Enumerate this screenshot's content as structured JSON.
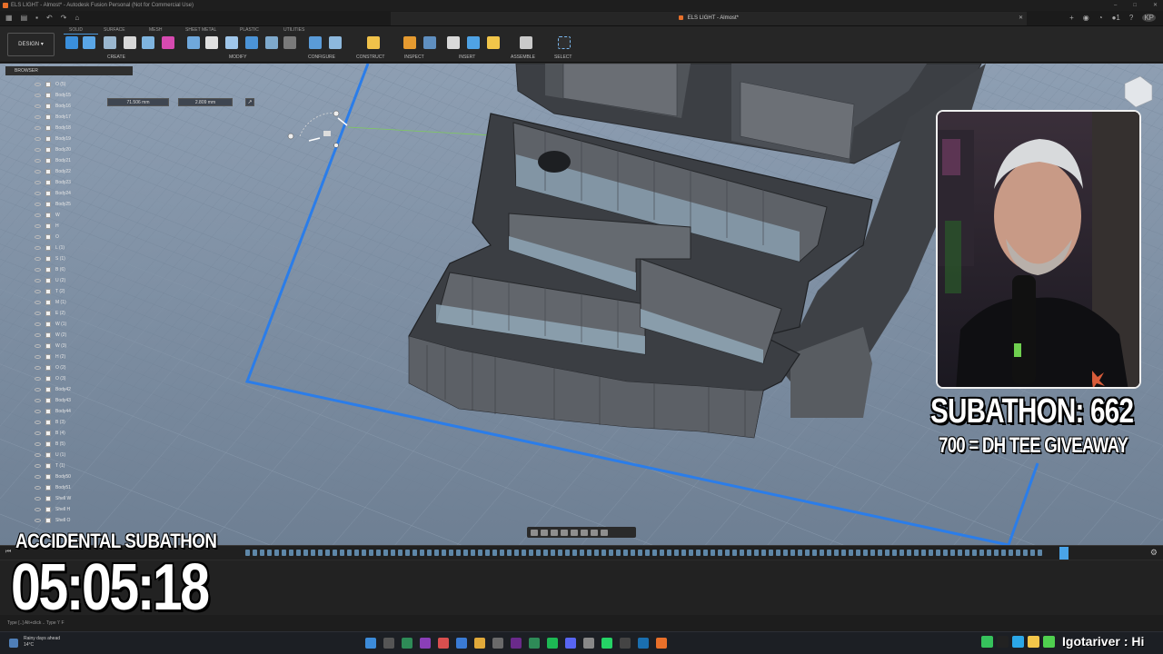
{
  "window": {
    "title": "ELS LIGHT - Almost* - Autodesk Fusion Personal (Not for Commercial Use)",
    "document_tab": "ELS LIGHT - Almost*",
    "user_initials": "KP",
    "notification_count": "1"
  },
  "ribbon": {
    "workspace": "DESIGN",
    "tabs": [
      "SOLID",
      "SURFACE",
      "MESH",
      "SHEET METAL",
      "PLASTIC",
      "UTILITIES"
    ],
    "groups": [
      "CREATE",
      "MODIFY",
      "CONFIGURE",
      "CONSTRUCT",
      "INSPECT",
      "INSERT",
      "ASSEMBLE",
      "SELECT"
    ]
  },
  "browser": {
    "title": "BROWSER",
    "items": [
      "O (5)",
      "Body15",
      "Body16",
      "Body17",
      "Body18",
      "Body19",
      "Body20",
      "Body21",
      "Body22",
      "Body23",
      "Body24",
      "Body25",
      "W",
      "H",
      "O",
      "L (1)",
      "S (1)",
      "B (6)",
      "U (2)",
      "T (2)",
      "M (1)",
      "E (2)",
      "W (1)",
      "W (2)",
      "W (3)",
      "H (2)",
      "O (2)",
      "O (3)",
      "Body42",
      "Body43",
      "Body44",
      "B (3)",
      "B (4)",
      "B (5)",
      "U (1)",
      "T (1)",
      "Body50",
      "Body51",
      "Shell W",
      "Shell H",
      "Shell O"
    ]
  },
  "dimensions": {
    "first": "71.506 mm",
    "second": "2.809 mm"
  },
  "status": {
    "hint": "Type [..] Alt+click .. Type 'i' F"
  },
  "overlay": {
    "subathon_label": "ACCIDENTAL SUBATHON",
    "timer": "05:05:18",
    "subathon_count": "SUBATHON: 662",
    "giveaway": "700 = DH TEE GIVEAWAY"
  },
  "taskbar": {
    "weather_line1": "Rainy days ahead",
    "weather_line2": "14°C"
  },
  "chat": {
    "username": "Igotariver",
    "message": ": Hi"
  },
  "colors": {
    "accent_blue": "#2b7de9",
    "brand_orange": "#e8702a"
  }
}
